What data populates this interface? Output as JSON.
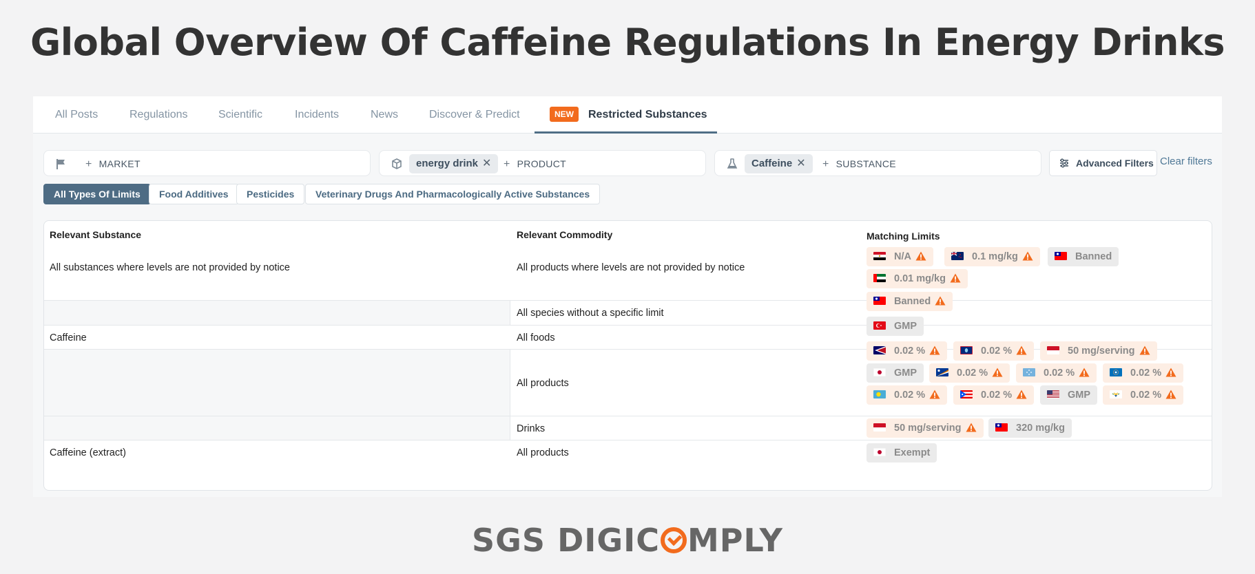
{
  "page": {
    "title": "Global Overview Of Caffeine Regulations In Energy Drinks"
  },
  "tabs": [
    {
      "label": "All Posts"
    },
    {
      "label": "Regulations"
    },
    {
      "label": "Scientific"
    },
    {
      "label": "Incidents"
    },
    {
      "label": "News"
    },
    {
      "label": "Discover & Predict"
    },
    {
      "label": "Restricted Substances",
      "badge": "NEW",
      "active": true
    }
  ],
  "filters": {
    "market": {
      "add_label": "MARKET",
      "icon": "flag-icon"
    },
    "product": {
      "chip": "energy drink",
      "add_label": "PRODUCT",
      "icon": "box-icon"
    },
    "substance": {
      "chip": "Caffeine",
      "add_label": "SUBSTANCE",
      "icon": "flask-icon"
    },
    "advanced_label": "Advanced Filters",
    "clear_label": "Clear filters"
  },
  "limit_types": [
    {
      "label": "All Types Of Limits",
      "active": true
    },
    {
      "label": "Food Additives"
    },
    {
      "label": "Pesticides"
    },
    {
      "label": "Veterinary Drugs And Pharmacologically Active Substances"
    }
  ],
  "table": {
    "headers": {
      "substance": "Relevant Substance",
      "commodity": "Relevant Commodity",
      "limits": "Matching Limits"
    },
    "rows": [
      {
        "substance": "All substances where levels are not provided by notice",
        "commodity": "All products where levels are not provided by notice"
      },
      {
        "substance": "",
        "commodity": "All species without a specific limit"
      },
      {
        "substance": "Caffeine",
        "commodity": "All foods"
      },
      {
        "substance": "",
        "commodity": "All products"
      },
      {
        "substance": "",
        "commodity": "Drinks"
      },
      {
        "substance": "Caffeine (extract)",
        "commodity": "All products"
      }
    ],
    "limits": [
      {
        "value": "N/A",
        "flag": "egypt-flag-icon",
        "warn": true
      },
      {
        "value": "0.1 mg/kg",
        "flag": "new-zealand-flag-icon",
        "warn": true
      },
      {
        "value": "Banned",
        "flag": "taiwan-flag-icon",
        "warn": false
      },
      {
        "value": "0.01 mg/kg",
        "flag": "uae-flag-icon",
        "warn": true
      },
      {
        "value": "Banned",
        "flag": "taiwan-flag-icon",
        "warn": true
      },
      {
        "value": "GMP",
        "flag": "turkey-flag-icon",
        "warn": false
      },
      {
        "value": "0.02 %",
        "flag": "american-samoa-flag-icon",
        "warn": true
      },
      {
        "value": "0.02 %",
        "flag": "guam-flag-icon",
        "warn": true
      },
      {
        "value": "50 mg/serving",
        "flag": "indonesia-flag-icon",
        "warn": true
      },
      {
        "value": "GMP",
        "flag": "japan-flag-icon",
        "warn": false
      },
      {
        "value": "0.02 %",
        "flag": "marshall-islands-flag-icon",
        "warn": true
      },
      {
        "value": "0.02 %",
        "flag": "micronesia-flag-icon",
        "warn": true
      },
      {
        "value": "0.02 %",
        "flag": "northern-mariana-flag-icon",
        "warn": true
      },
      {
        "value": "0.02 %",
        "flag": "palau-flag-icon",
        "warn": true
      },
      {
        "value": "0.02 %",
        "flag": "puerto-rico-flag-icon",
        "warn": true
      },
      {
        "value": "GMP",
        "flag": "usa-flag-icon",
        "warn": false
      },
      {
        "value": "0.02 %",
        "flag": "virgin-islands-flag-icon",
        "warn": true
      },
      {
        "value": "50 mg/serving",
        "flag": "indonesia-flag-icon",
        "warn": true
      },
      {
        "value": "320 mg/kg",
        "flag": "taiwan-flag-icon",
        "warn": false
      },
      {
        "value": "Exempt",
        "flag": "japan-flag-icon",
        "warn": false
      }
    ]
  },
  "logo": {
    "left": "SGS DIGIC",
    "right": "MPLY"
  }
}
